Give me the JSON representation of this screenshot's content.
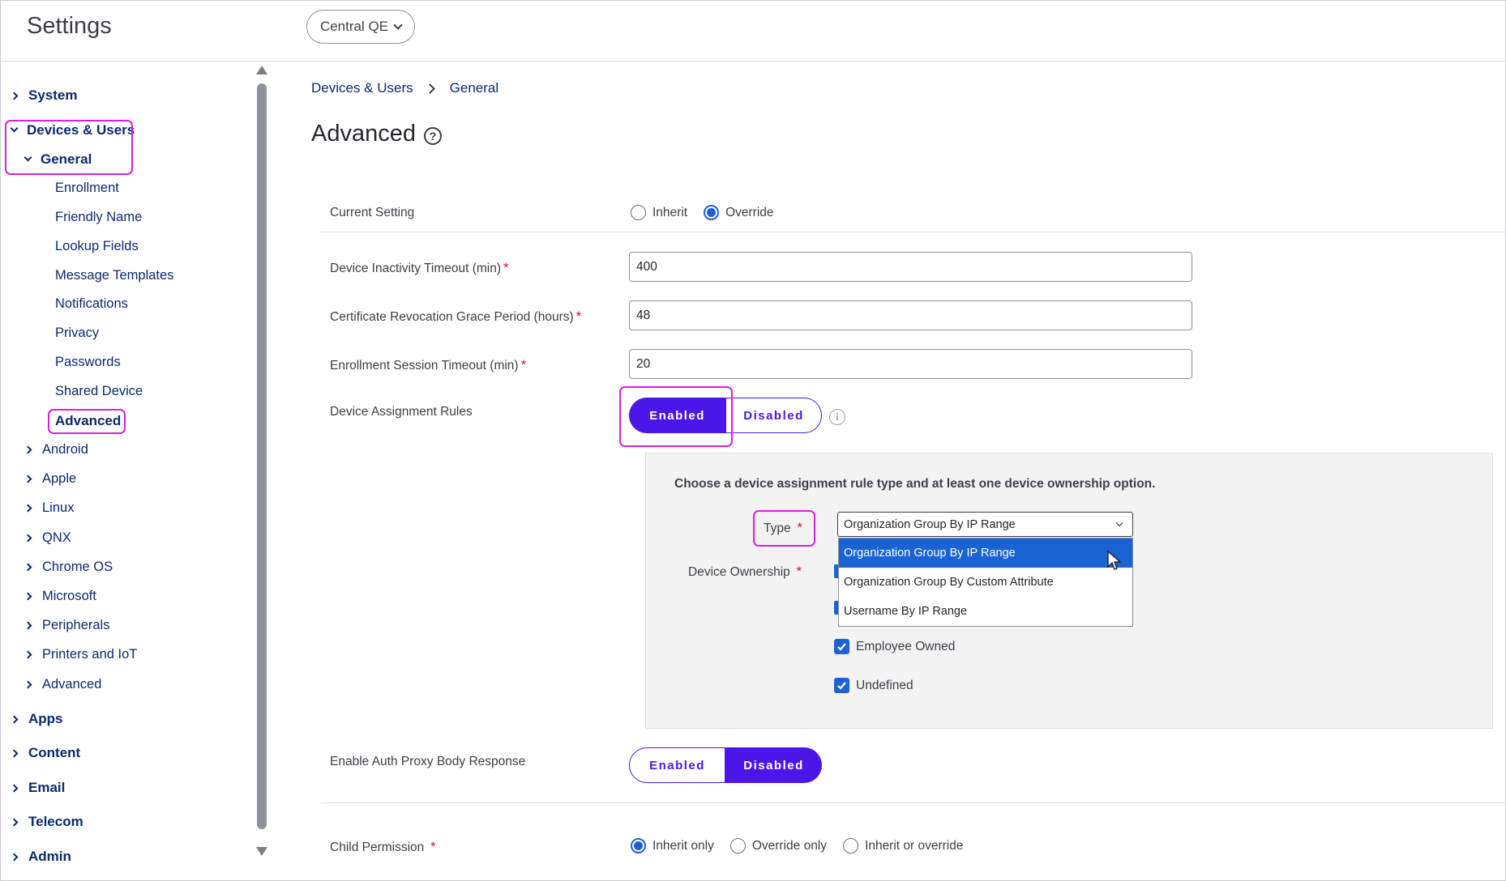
{
  "header": {
    "app_title": "Settings",
    "org_selector": "Central QE"
  },
  "sidebar": {
    "system": "System",
    "devices_users": "Devices & Users",
    "general": "General",
    "general_items": [
      "Enrollment",
      "Friendly Name",
      "Lookup Fields",
      "Message Templates",
      "Notifications",
      "Privacy",
      "Passwords",
      "Shared Device",
      "Advanced"
    ],
    "platforms": [
      "Android",
      "Apple",
      "Linux",
      "QNX",
      "Chrome OS",
      "Microsoft",
      "Peripherals",
      "Printers and IoT",
      "Advanced"
    ],
    "bottom": [
      "Apps",
      "Content",
      "Email",
      "Telecom",
      "Admin"
    ]
  },
  "breadcrumb": {
    "parent": "Devices & Users",
    "current": "General"
  },
  "page": {
    "title": "Advanced",
    "help_icon": "question-circle-icon"
  },
  "form": {
    "current_setting": {
      "label": "Current Setting",
      "options": [
        "Inherit",
        "Override"
      ],
      "selected": "Override"
    },
    "device_inactivity": {
      "label": "Device Inactivity Timeout (min)",
      "value": "400"
    },
    "cert_revocation": {
      "label": "Certificate Revocation Grace Period (hours)",
      "value": "48"
    },
    "enrollment_session": {
      "label": "Enrollment Session Timeout (min)",
      "value": "20"
    },
    "device_assignment_rules": {
      "label": "Device Assignment Rules",
      "enabled": "Enabled",
      "disabled": "Disabled",
      "selected": "Enabled"
    },
    "rule_panel": {
      "heading": "Choose a device assignment rule type and at least one device ownership option.",
      "type_label": "Type",
      "type_value": "Organization Group By IP Range",
      "type_options": [
        "Organization Group By IP Range",
        "Organization Group By Custom Attribute",
        "Username By IP Range"
      ],
      "ownership_label": "Device Ownership",
      "ownership_options": [
        "Employee Owned",
        "Undefined"
      ]
    },
    "auth_proxy": {
      "label": "Enable Auth Proxy Body Response",
      "enabled": "Enabled",
      "disabled": "Disabled",
      "selected": "Disabled"
    },
    "child_permission": {
      "label": "Child Permission",
      "options": [
        "Inherit only",
        "Override only",
        "Inherit or override"
      ],
      "selected": "Inherit only"
    }
  },
  "colors": {
    "accent": "#4b16e8",
    "select_blue": "#1b63d5",
    "highlight": "#d81fe0",
    "nav_text": "#0b2a6b"
  }
}
